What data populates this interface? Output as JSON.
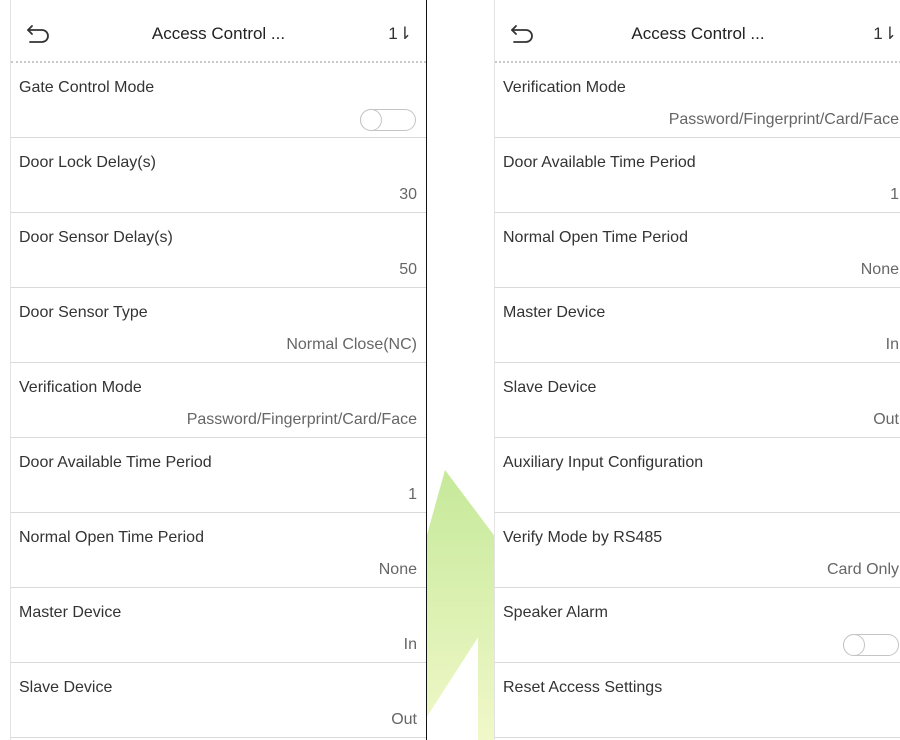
{
  "left_screen": {
    "header": {
      "title": "Access Control ...",
      "back_icon": "back-arrow-icon",
      "sort_glyph": "1⇂"
    },
    "rows": [
      {
        "label": "Gate Control Mode",
        "value": "",
        "type": "toggle",
        "state": "off"
      },
      {
        "label": "Door Lock Delay(s)",
        "value": "30"
      },
      {
        "label": "Door Sensor Delay(s)",
        "value": "50"
      },
      {
        "label": "Door Sensor Type",
        "value": "Normal Close(NC)"
      },
      {
        "label": "Verification Mode",
        "value": "Password/Fingerprint/Card/Face"
      },
      {
        "label": "Door Available Time Period",
        "value": "1"
      },
      {
        "label": "Normal Open Time Period",
        "value": "None"
      },
      {
        "label": "Master Device",
        "value": "In"
      },
      {
        "label": "Slave Device",
        "value": "Out"
      }
    ]
  },
  "right_screen": {
    "header": {
      "title": "Access Control ...",
      "back_icon": "back-arrow-icon",
      "sort_glyph": "1⇂"
    },
    "rows": [
      {
        "label": "Verification Mode",
        "value": "Password/Fingerprint/Card/Face"
      },
      {
        "label": "Door Available Time Period",
        "value": "1"
      },
      {
        "label": "Normal Open Time Period",
        "value": "None"
      },
      {
        "label": "Master Device",
        "value": "In"
      },
      {
        "label": "Slave Device",
        "value": "Out"
      },
      {
        "label": "Auxiliary Input Configuration",
        "value": ""
      },
      {
        "label": "Verify Mode by RS485",
        "value": "Card Only"
      },
      {
        "label": "Speaker Alarm",
        "value": "",
        "type": "toggle",
        "state": "off"
      },
      {
        "label": "Reset Access Settings",
        "value": ""
      }
    ]
  },
  "colors": {
    "watermark": "#a8d860",
    "divider": "#d9d9d9",
    "text": "#333333",
    "value_text": "#666666"
  }
}
